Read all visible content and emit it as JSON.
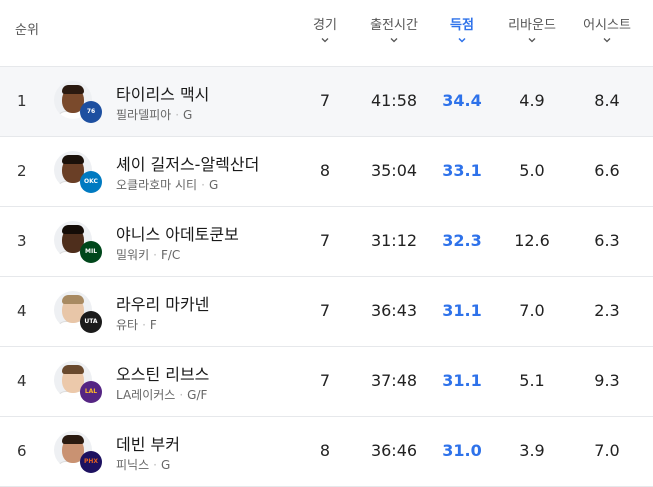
{
  "header": {
    "rank": "순위",
    "games": "경기",
    "minutes": "출전시간",
    "points": "득점",
    "rebounds": "리바운드",
    "assists": "어시스트"
  },
  "players": [
    {
      "rank": "1",
      "name": "타이리스 맥시",
      "team": "필라델피아",
      "pos": "G",
      "games": "7",
      "minutes": "41:58",
      "points": "34.4",
      "rebounds": "4.9",
      "assists": "8.4",
      "logo": "76ers-logo"
    },
    {
      "rank": "2",
      "name": "셰이 길저스-알렉산더",
      "team": "오클라호마 시티",
      "pos": "G",
      "games": "8",
      "minutes": "35:04",
      "points": "33.1",
      "rebounds": "5.0",
      "assists": "6.6",
      "logo": "thunder-logo"
    },
    {
      "rank": "3",
      "name": "야니스 아데토쿤보",
      "team": "밀워키",
      "pos": "F/C",
      "games": "7",
      "minutes": "31:12",
      "points": "32.3",
      "rebounds": "12.6",
      "assists": "6.3",
      "logo": "bucks-logo"
    },
    {
      "rank": "4",
      "name": "라우리 마카넨",
      "team": "유타",
      "pos": "F",
      "games": "7",
      "minutes": "36:43",
      "points": "31.1",
      "rebounds": "7.0",
      "assists": "2.3",
      "logo": "jazz-logo"
    },
    {
      "rank": "4",
      "name": "오스틴 리브스",
      "team": "LA레이커스",
      "pos": "G/F",
      "games": "7",
      "minutes": "37:48",
      "points": "31.1",
      "rebounds": "5.1",
      "assists": "9.3",
      "logo": "lakers-logo"
    },
    {
      "rank": "6",
      "name": "데빈 부커",
      "team": "피닉스",
      "pos": "G",
      "games": "8",
      "minutes": "36:46",
      "points": "31.0",
      "rebounds": "3.9",
      "assists": "7.0",
      "logo": "suns-logo"
    }
  ],
  "colors": {
    "accent": "#2e72ea",
    "highlight_row": "#f6f7f9",
    "divider": "#e6e8eb"
  }
}
